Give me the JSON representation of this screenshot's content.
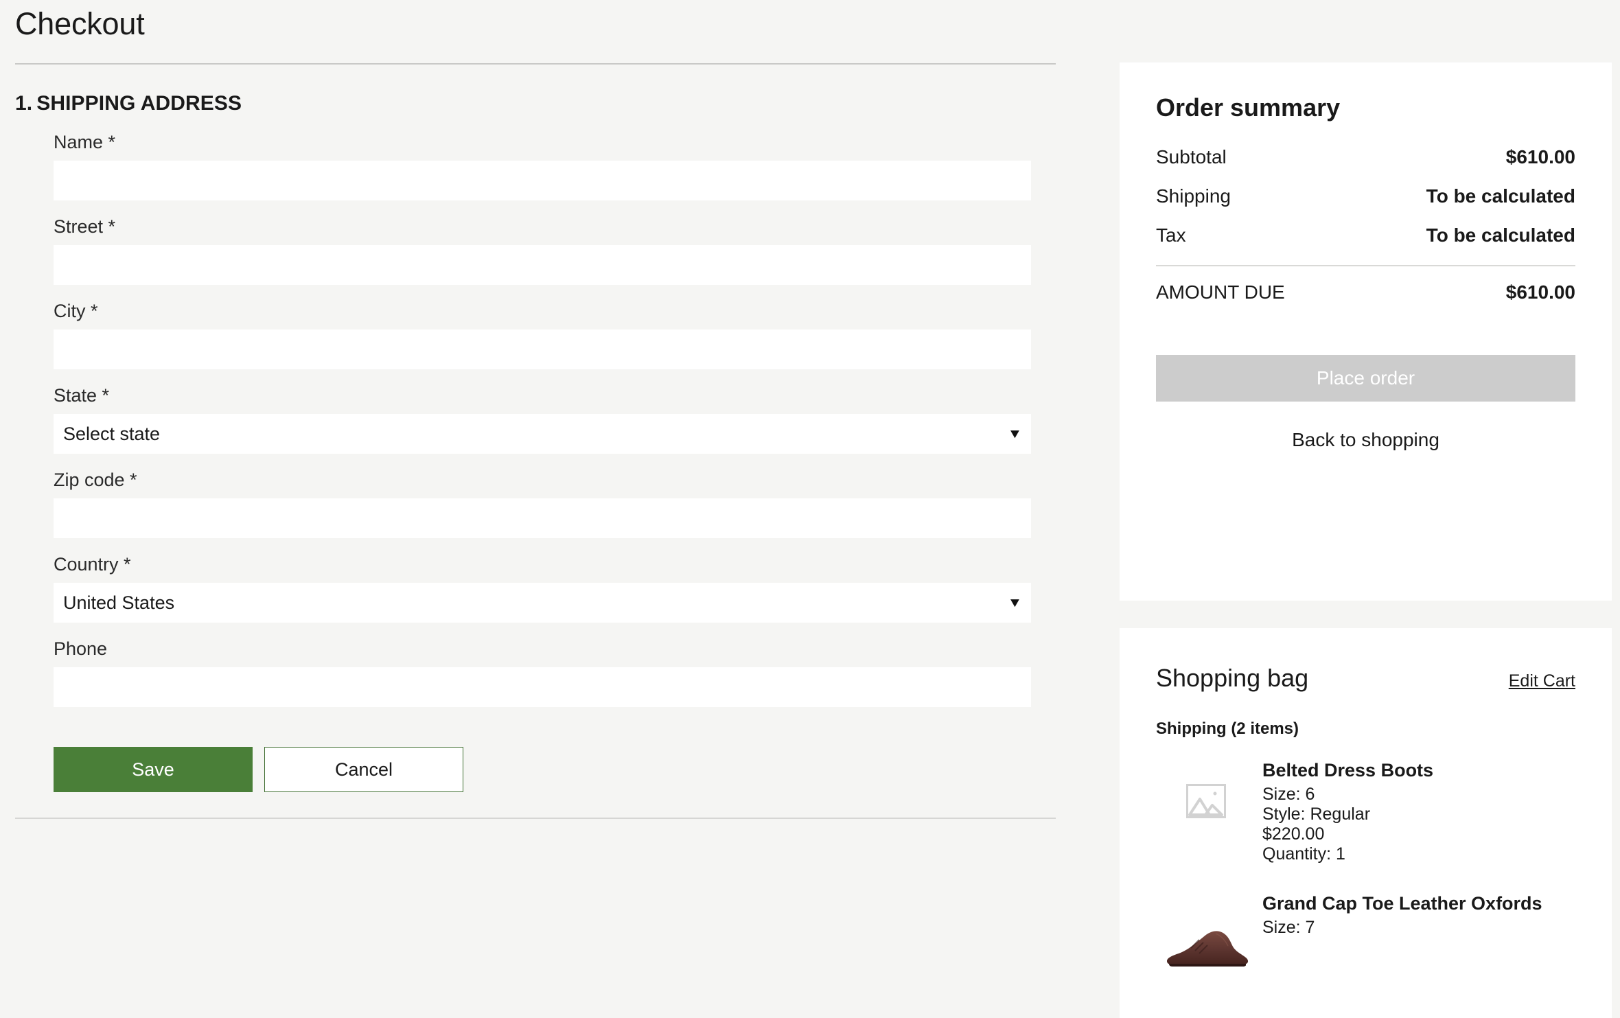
{
  "header": {
    "title": "Checkout"
  },
  "shipping_section": {
    "number": "1.",
    "heading": "SHIPPING ADDRESS",
    "fields": [
      {
        "label": "Name *",
        "value": "",
        "placeholder": ""
      },
      {
        "label": "Street *",
        "value": "",
        "placeholder": ""
      },
      {
        "label": "City *",
        "value": "",
        "placeholder": ""
      }
    ],
    "state": {
      "label": "State *",
      "value": "Select state",
      "caret": "chevron-down-icon"
    },
    "zip": {
      "label": "Zip code *",
      "value": "",
      "placeholder": ""
    },
    "country": {
      "label": "Country *",
      "value": "United States",
      "caret": "chevron-down-icon"
    },
    "phone": {
      "label": "Phone",
      "value": "",
      "placeholder": ""
    },
    "save_label": "Save",
    "cancel_label": "Cancel"
  },
  "order_summary": {
    "title": "Order summary",
    "rows": [
      {
        "label": "Subtotal",
        "value": "$610.00"
      },
      {
        "label": "Shipping",
        "value": "To be calculated"
      },
      {
        "label": "Tax",
        "value": "To be calculated"
      }
    ],
    "total": {
      "label": "AMOUNT DUE",
      "value": "$610.00"
    },
    "place_order_label": "Place order",
    "back_link_label": "Back to shopping"
  },
  "shopping_bag": {
    "title": "Shopping bag",
    "edit_cart_label": "Edit Cart",
    "shipping_group_label": "Shipping (2 items)",
    "items": [
      {
        "name": "Belted Dress Boots",
        "size": "Size: 6",
        "style": "Style: Regular",
        "price": "$220.00",
        "quantity": "Quantity: 1",
        "thumb": "image-placeholder-icon"
      },
      {
        "name": "Grand Cap Toe Leather Oxfords",
        "size": "Size: 7",
        "style": "",
        "price": "",
        "quantity": "",
        "thumb": "brown-oxford-shoe-photo"
      }
    ]
  },
  "colors": {
    "page_bg": "#f5f5f3",
    "panel_bg": "#ffffff",
    "save_green": "#4a7f38",
    "place_order_gray": "#cccccc",
    "rule_gray": "#c9c9c7"
  }
}
